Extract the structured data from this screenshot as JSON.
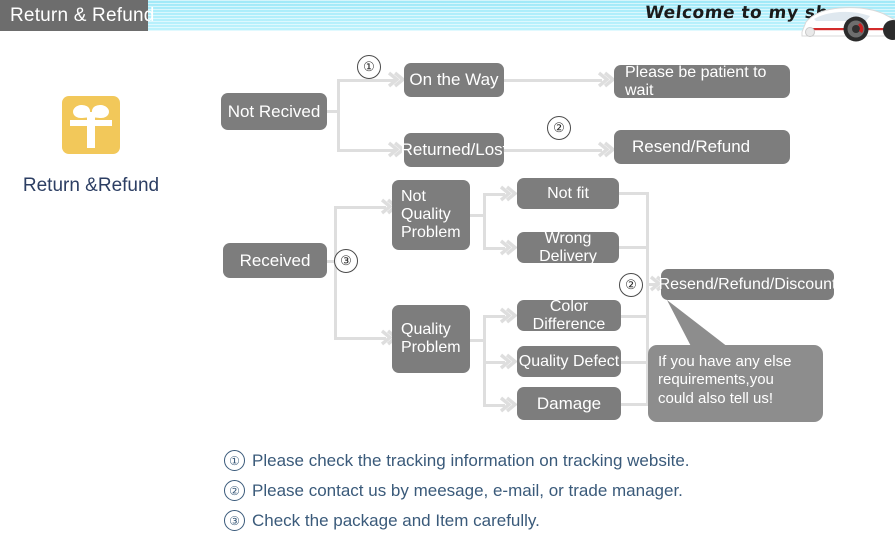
{
  "banner": {
    "title_tab": "Return & Refund",
    "shop_text": "Welcome to my shop",
    "car_icon": "sports-car-icon",
    "banner_color": "#aeeefb",
    "tab_color": "#6d6d6d"
  },
  "gift": {
    "icon": "gift-box-icon",
    "icon_color": "#f2c85a",
    "label": "Return &Refund",
    "label_color": "#2c3e63"
  },
  "flow": {
    "node_color": "#7d7d7d",
    "line_color": "#dedede",
    "nodes": [
      {
        "id": "not_received",
        "label": "Not Recived"
      },
      {
        "id": "on_the_way",
        "label": "On the Way"
      },
      {
        "id": "returned_lost",
        "label": "Returned/Lost"
      },
      {
        "id": "please_wait",
        "label": "Please be patient to wait"
      },
      {
        "id": "resend_refund",
        "label": "Resend/Refund"
      },
      {
        "id": "received",
        "label": "Received"
      },
      {
        "id": "not_quality",
        "label": "Not Quality Problem"
      },
      {
        "id": "not_fit",
        "label": "Not fit"
      },
      {
        "id": "wrong_delivery",
        "label": "Wrong Delivery"
      },
      {
        "id": "quality_problem",
        "label": "Quality Problem"
      },
      {
        "id": "color_difference",
        "label": "Color Difference"
      },
      {
        "id": "quality_defect",
        "label": "Quality Defect"
      },
      {
        "id": "damage",
        "label": "Damage"
      },
      {
        "id": "resend_discount",
        "label": "Resend/Refund/Discount"
      }
    ],
    "markers": {
      "m1": "①",
      "m2_top": "②",
      "m3": "③",
      "m2_bottom": "②"
    }
  },
  "bubble": {
    "text": "If you have any else requirements,you could also tell us!",
    "color": "#8d8d8d"
  },
  "footnotes": [
    {
      "num": "①",
      "text": "Please check the tracking information on tracking website."
    },
    {
      "num": "②",
      "text": "Please contact us by meesage, e-mail, or trade manager."
    },
    {
      "num": "③",
      "text": "Check the package and Item carefully."
    }
  ]
}
